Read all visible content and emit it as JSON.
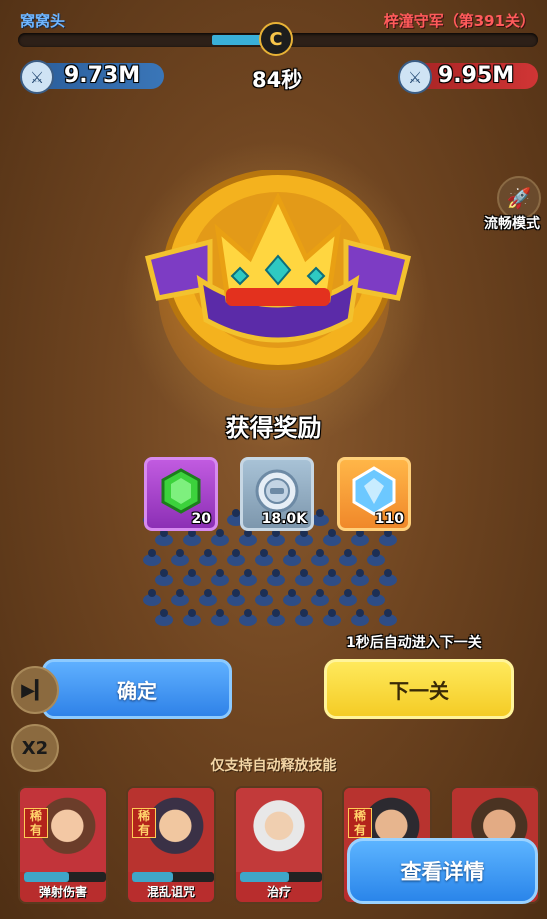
{
  "top": {
    "player_name": "窝窝头",
    "enemy_name": "梓潼守军（第391关）",
    "player_power": "9.73M",
    "enemy_power": "9.95M",
    "timer": "84秒"
  },
  "side": {
    "fluent_mode_label": "流畅模式"
  },
  "reward": {
    "title": "获得奖励",
    "items": [
      {
        "icon": "green-gem-icon",
        "quantity": "20"
      },
      {
        "icon": "silver-coin-icon",
        "quantity": "18.0K"
      },
      {
        "icon": "blue-diamond-icon",
        "quantity": "110"
      }
    ],
    "auto_next_text": "1秒后自动进入下一关"
  },
  "buttons": {
    "confirm": "确定",
    "next_level": "下一关",
    "speed": "X2",
    "view_details": "查看详情"
  },
  "skills": {
    "hint": "仅支持自动释放技能",
    "heroes": [
      {
        "tag": "稀有",
        "name": "弹射伤害",
        "progress": 0.55
      },
      {
        "tag": "稀有",
        "name": "混乱诅咒",
        "progress": 0.5
      },
      {
        "tag": "",
        "name": "治疗",
        "progress": 0.6
      },
      {
        "tag": "稀有",
        "name": "",
        "progress": 0.5
      },
      {
        "tag": "",
        "name": "",
        "progress": 0.5
      }
    ]
  },
  "colors": {
    "player": "#6fb6ff",
    "enemy": "#ff5b5b",
    "confirm_button": "#3a94f0",
    "next_button": "#f6d334"
  }
}
